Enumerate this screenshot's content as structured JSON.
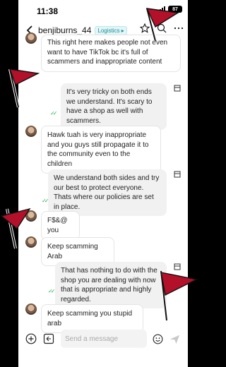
{
  "status": {
    "time": "11:38",
    "battery": "87"
  },
  "header": {
    "username": "benjiburns_44",
    "tag": "Logistics"
  },
  "messages": [
    {
      "side": "in",
      "text": "This right here makes people not even want to have TikTok bc it's full of scammers and inappropriate content"
    },
    {
      "side": "out",
      "text": "It's very tricky on both ends we understand. It's scary to have a shop as well with scammers."
    },
    {
      "side": "in",
      "text": "Hawk tuah is very inappropriate and you guys still propagate it to the community even to the children"
    },
    {
      "side": "out",
      "text": "We understand both sides and try our best to protect everyone. Thats where our policies are set in place."
    },
    {
      "side": "in",
      "text": "F$&@ you"
    },
    {
      "side": "in",
      "text": "Keep scamming Arab"
    },
    {
      "side": "out",
      "text": "That has nothing to do with the shop you are dealing with now that is appropriate and highly regarded."
    },
    {
      "side": "in",
      "text": "Keep scamming you stupid arab"
    }
  ],
  "composer": {
    "placeholder": "Send a message"
  },
  "icons": [
    "back-chevron-icon",
    "play-icon",
    "star-icon",
    "search-icon",
    "more-icon",
    "plus-icon",
    "image-icon",
    "emoji-icon",
    "send-icon",
    "read-check-icon",
    "shop-icon",
    "red-flag-icon"
  ],
  "colors": {
    "flag": "#b3102a",
    "check": "#21b14a",
    "tag": "#1a8f9a"
  }
}
